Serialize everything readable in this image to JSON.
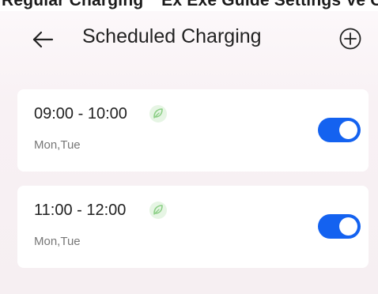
{
  "top_strip": {
    "text": "Regular Charging      Ex Exe Guide Settings   Ve Cl   Cl  Cl  Dl"
  },
  "header": {
    "back_icon": "arrow-left-icon",
    "title": "Scheduled Charging",
    "add_icon": "plus-circle-icon"
  },
  "schedules": [
    {
      "time": "09:00 - 10:00",
      "days": "Mon,Tue",
      "eco_icon": "leaf-icon",
      "enabled": true
    },
    {
      "time": "11:00 - 12:00",
      "days": "Mon,Tue",
      "eco_icon": "leaf-icon",
      "enabled": true
    }
  ],
  "colors": {
    "accent": "#1462f0",
    "eco_green": "#8ccf86",
    "background": "#f8f1f4"
  }
}
